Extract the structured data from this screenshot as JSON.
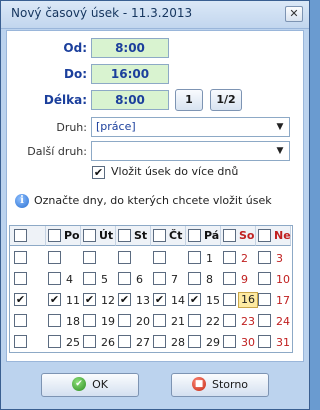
{
  "window": {
    "title": "Nový časový úsek - 11.3.2013",
    "close_glyph": "✕"
  },
  "form": {
    "od_label": "Od:",
    "od_value": "8:00",
    "do_label": "Do:",
    "do_value": "16:00",
    "delka_label": "Délka:",
    "delka_value": "8:00",
    "btn_1": "1",
    "btn_half": "1/2",
    "druh_label": "Druh:",
    "druh_value": "[práce]",
    "dalsi_druh_label": "Další druh:",
    "dalsi_druh_value": "",
    "multi_day_label": "Vložit úsek do více dnů",
    "multi_day_checked": true
  },
  "info": {
    "text": "Označte dny, do kterých chcete vložit úsek"
  },
  "calendar": {
    "headers": [
      "Po",
      "Út",
      "St",
      "Čt",
      "Pá",
      "So",
      "Ne"
    ],
    "weekend_color": "#c02020",
    "today_day": 16,
    "rows": [
      {
        "checked": false,
        "days": [
          null,
          null,
          null,
          null,
          1,
          2,
          3
        ],
        "checks": [
          false,
          false,
          false,
          false,
          false,
          false,
          false
        ]
      },
      {
        "checked": false,
        "days": [
          4,
          5,
          6,
          7,
          8,
          9,
          10
        ],
        "checks": [
          false,
          false,
          false,
          false,
          false,
          false,
          false
        ]
      },
      {
        "checked": true,
        "days": [
          11,
          12,
          13,
          14,
          15,
          16,
          17
        ],
        "checks": [
          true,
          true,
          true,
          true,
          true,
          false,
          false
        ]
      },
      {
        "checked": false,
        "days": [
          18,
          19,
          20,
          21,
          22,
          23,
          24
        ],
        "checks": [
          false,
          false,
          false,
          false,
          false,
          false,
          false
        ]
      },
      {
        "checked": false,
        "days": [
          25,
          26,
          27,
          28,
          29,
          30,
          31
        ],
        "checks": [
          false,
          false,
          false,
          false,
          false,
          false,
          false
        ]
      }
    ]
  },
  "buttons": {
    "ok_label": "OK",
    "cancel_label": "Storno"
  },
  "icons": {
    "check_glyph": "✔",
    "dropdown_glyph": "▼",
    "info_glyph": "i",
    "ok_glyph": "✔",
    "cancel_glyph": "■"
  }
}
